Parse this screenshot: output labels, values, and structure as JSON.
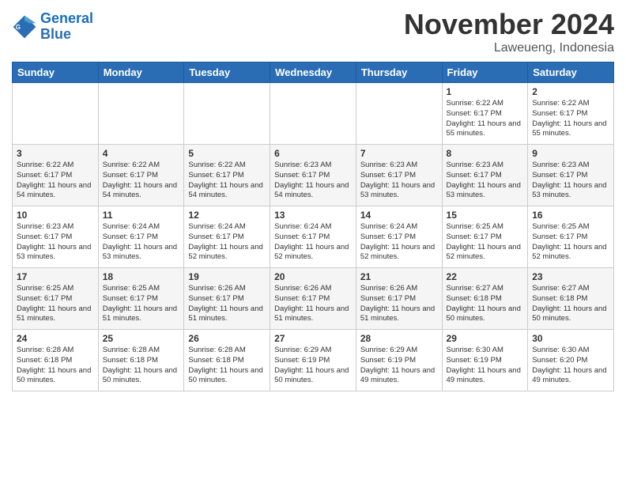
{
  "logo": {
    "line1": "General",
    "line2": "Blue"
  },
  "title": "November 2024",
  "location": "Laweueng, Indonesia",
  "days_of_week": [
    "Sunday",
    "Monday",
    "Tuesday",
    "Wednesday",
    "Thursday",
    "Friday",
    "Saturday"
  ],
  "weeks": [
    [
      {
        "day": "",
        "info": ""
      },
      {
        "day": "",
        "info": ""
      },
      {
        "day": "",
        "info": ""
      },
      {
        "day": "",
        "info": ""
      },
      {
        "day": "",
        "info": ""
      },
      {
        "day": "1",
        "info": "Sunrise: 6:22 AM\nSunset: 6:17 PM\nDaylight: 11 hours and 55 minutes."
      },
      {
        "day": "2",
        "info": "Sunrise: 6:22 AM\nSunset: 6:17 PM\nDaylight: 11 hours and 55 minutes."
      }
    ],
    [
      {
        "day": "3",
        "info": "Sunrise: 6:22 AM\nSunset: 6:17 PM\nDaylight: 11 hours and 54 minutes."
      },
      {
        "day": "4",
        "info": "Sunrise: 6:22 AM\nSunset: 6:17 PM\nDaylight: 11 hours and 54 minutes."
      },
      {
        "day": "5",
        "info": "Sunrise: 6:22 AM\nSunset: 6:17 PM\nDaylight: 11 hours and 54 minutes."
      },
      {
        "day": "6",
        "info": "Sunrise: 6:23 AM\nSunset: 6:17 PM\nDaylight: 11 hours and 54 minutes."
      },
      {
        "day": "7",
        "info": "Sunrise: 6:23 AM\nSunset: 6:17 PM\nDaylight: 11 hours and 53 minutes."
      },
      {
        "day": "8",
        "info": "Sunrise: 6:23 AM\nSunset: 6:17 PM\nDaylight: 11 hours and 53 minutes."
      },
      {
        "day": "9",
        "info": "Sunrise: 6:23 AM\nSunset: 6:17 PM\nDaylight: 11 hours and 53 minutes."
      }
    ],
    [
      {
        "day": "10",
        "info": "Sunrise: 6:23 AM\nSunset: 6:17 PM\nDaylight: 11 hours and 53 minutes."
      },
      {
        "day": "11",
        "info": "Sunrise: 6:24 AM\nSunset: 6:17 PM\nDaylight: 11 hours and 53 minutes."
      },
      {
        "day": "12",
        "info": "Sunrise: 6:24 AM\nSunset: 6:17 PM\nDaylight: 11 hours and 52 minutes."
      },
      {
        "day": "13",
        "info": "Sunrise: 6:24 AM\nSunset: 6:17 PM\nDaylight: 11 hours and 52 minutes."
      },
      {
        "day": "14",
        "info": "Sunrise: 6:24 AM\nSunset: 6:17 PM\nDaylight: 11 hours and 52 minutes."
      },
      {
        "day": "15",
        "info": "Sunrise: 6:25 AM\nSunset: 6:17 PM\nDaylight: 11 hours and 52 minutes."
      },
      {
        "day": "16",
        "info": "Sunrise: 6:25 AM\nSunset: 6:17 PM\nDaylight: 11 hours and 52 minutes."
      }
    ],
    [
      {
        "day": "17",
        "info": "Sunrise: 6:25 AM\nSunset: 6:17 PM\nDaylight: 11 hours and 51 minutes."
      },
      {
        "day": "18",
        "info": "Sunrise: 6:25 AM\nSunset: 6:17 PM\nDaylight: 11 hours and 51 minutes."
      },
      {
        "day": "19",
        "info": "Sunrise: 6:26 AM\nSunset: 6:17 PM\nDaylight: 11 hours and 51 minutes."
      },
      {
        "day": "20",
        "info": "Sunrise: 6:26 AM\nSunset: 6:17 PM\nDaylight: 11 hours and 51 minutes."
      },
      {
        "day": "21",
        "info": "Sunrise: 6:26 AM\nSunset: 6:17 PM\nDaylight: 11 hours and 51 minutes."
      },
      {
        "day": "22",
        "info": "Sunrise: 6:27 AM\nSunset: 6:18 PM\nDaylight: 11 hours and 50 minutes."
      },
      {
        "day": "23",
        "info": "Sunrise: 6:27 AM\nSunset: 6:18 PM\nDaylight: 11 hours and 50 minutes."
      }
    ],
    [
      {
        "day": "24",
        "info": "Sunrise: 6:28 AM\nSunset: 6:18 PM\nDaylight: 11 hours and 50 minutes."
      },
      {
        "day": "25",
        "info": "Sunrise: 6:28 AM\nSunset: 6:18 PM\nDaylight: 11 hours and 50 minutes."
      },
      {
        "day": "26",
        "info": "Sunrise: 6:28 AM\nSunset: 6:18 PM\nDaylight: 11 hours and 50 minutes."
      },
      {
        "day": "27",
        "info": "Sunrise: 6:29 AM\nSunset: 6:19 PM\nDaylight: 11 hours and 50 minutes."
      },
      {
        "day": "28",
        "info": "Sunrise: 6:29 AM\nSunset: 6:19 PM\nDaylight: 11 hours and 49 minutes."
      },
      {
        "day": "29",
        "info": "Sunrise: 6:30 AM\nSunset: 6:19 PM\nDaylight: 11 hours and 49 minutes."
      },
      {
        "day": "30",
        "info": "Sunrise: 6:30 AM\nSunset: 6:20 PM\nDaylight: 11 hours and 49 minutes."
      }
    ]
  ]
}
